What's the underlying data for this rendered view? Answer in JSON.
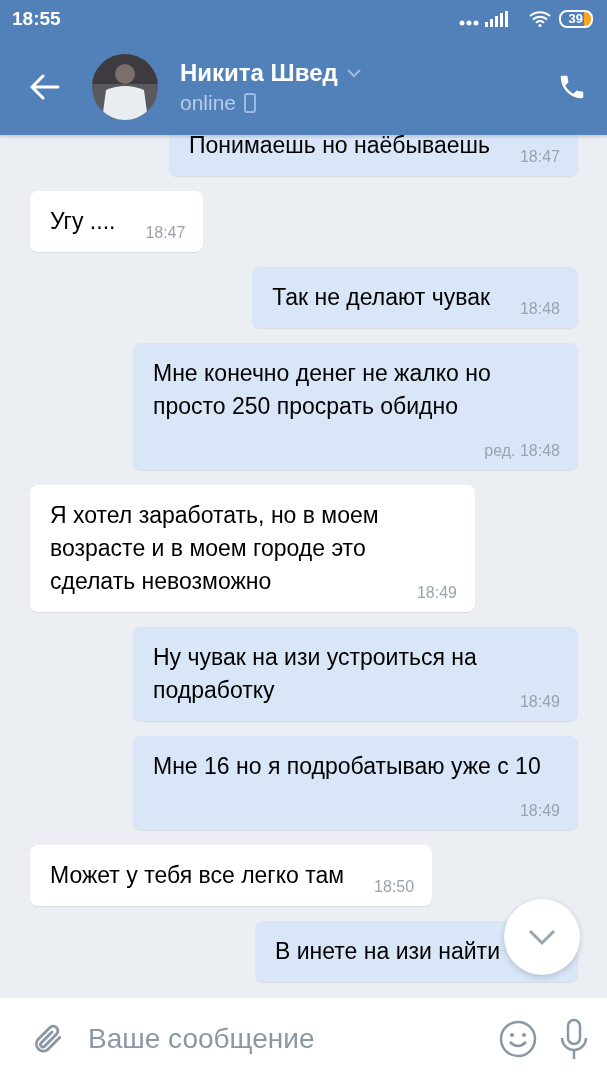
{
  "status_bar": {
    "time": "18:55",
    "battery": "39"
  },
  "header": {
    "name": "Никита Швед",
    "status": "online"
  },
  "messages": [
    {
      "text": "Понимаешь но наёбываешь",
      "time": "18:47",
      "outgoing": true
    },
    {
      "text": "Угу ....",
      "time": "18:47",
      "outgoing": false
    },
    {
      "text": "Так не делают чувак",
      "time": "18:48",
      "outgoing": true
    },
    {
      "text": "Мне конечно денег не жалко но просто 250 просрать обидно",
      "time": "ред. 18:48",
      "outgoing": true
    },
    {
      "text": "Я хотел заработать, но в моем возрасте и в моем городе это сделать невозможно",
      "time": "18:49",
      "outgoing": false
    },
    {
      "text": "Ну чувак на изи устроиться на подработку",
      "time": "18:49",
      "outgoing": true
    },
    {
      "text": "Мне 16 но я подробатываю уже с 10",
      "time": "18:49",
      "outgoing": true
    },
    {
      "text": "Может у тебя все легко там",
      "time": "18:50",
      "outgoing": false
    },
    {
      "text": "В инете на изи найти",
      "outgoing": true
    }
  ],
  "composer": {
    "placeholder": "Ваше сообщение"
  }
}
